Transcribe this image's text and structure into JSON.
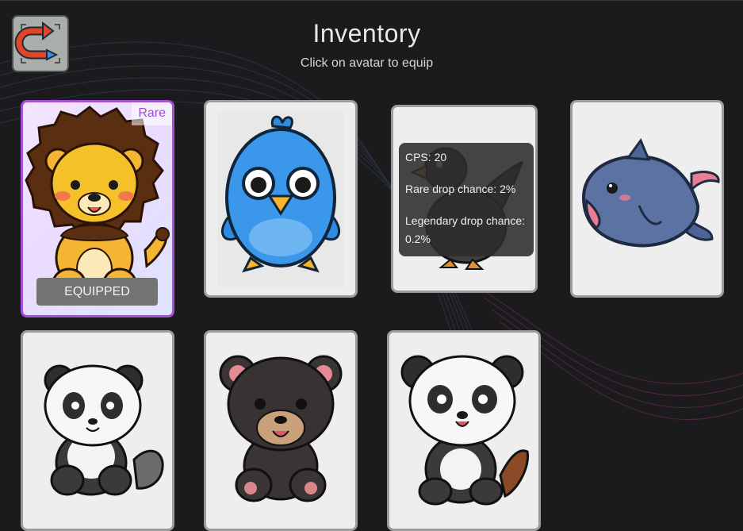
{
  "header": {
    "title": "Inventory",
    "subtitle": "Click on avatar to equip"
  },
  "back_button": {
    "icon": "return-arrow-icon"
  },
  "colors": {
    "background": "#1b1b1d",
    "card": "#eeeeee",
    "card_border": "#9c9c9c",
    "equipped_border": "#a64fd9",
    "rare_text": "#9a4fd0"
  },
  "avatars": [
    {
      "animal": "lion",
      "rarity": "Rare",
      "equipped": true,
      "badge": "EQUIPPED"
    },
    {
      "animal": "blue-bird"
    },
    {
      "animal": "black-duck",
      "tooltip": {
        "cps": "CPS: 20",
        "rare": "Rare drop chance: 2%",
        "legendary": "Legendary drop chance: 0.2%"
      }
    },
    {
      "animal": "dolphin"
    },
    {
      "animal": "panda"
    },
    {
      "animal": "black-bear"
    },
    {
      "animal": "panda-red-tail"
    }
  ]
}
